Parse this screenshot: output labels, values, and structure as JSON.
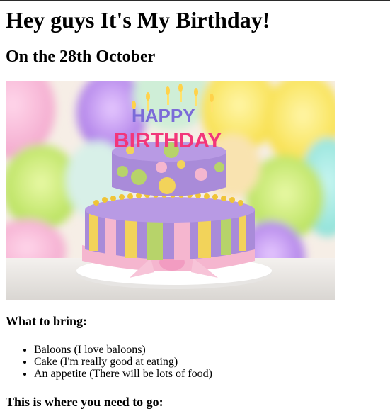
{
  "heading": "Hey guys It's My Birthday!",
  "subheading": "On the 28th October",
  "image": {
    "alt": "Birthday cake with Happy Birthday candles",
    "cake_topper_line1": "HAPPY",
    "cake_topper_line2": "BIRTHDAY"
  },
  "bring": {
    "title": "What to bring:",
    "items": [
      "Baloons (I love baloons)",
      "Cake (I'm really good at eating)",
      "An appetite (There will be lots of food)"
    ]
  },
  "directions_title": "This is where you need to go:",
  "colors": {
    "text": "#000000",
    "background": "#ffffff",
    "cake_purple": "#a98bd9",
    "cake_yellow": "#f2d35a",
    "cake_green": "#b7d36a",
    "cake_pink": "#f5b6cf"
  }
}
